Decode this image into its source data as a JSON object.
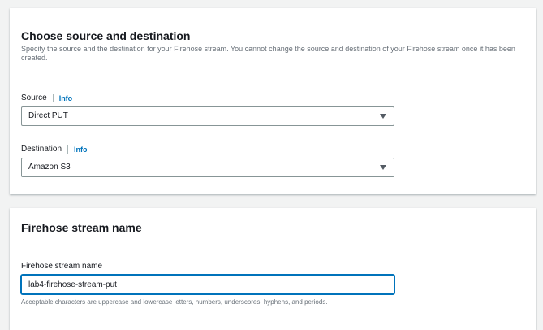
{
  "source_destination": {
    "title": "Choose source and destination",
    "description": "Specify the source and the destination for your Firehose stream. You cannot change the source and destination of your Firehose stream once it has been created.",
    "source": {
      "label": "Source",
      "info": "Info",
      "value": "Direct PUT"
    },
    "destination": {
      "label": "Destination",
      "info": "Info",
      "value": "Amazon S3"
    }
  },
  "stream_name": {
    "title": "Firehose stream name",
    "field_label": "Firehose stream name",
    "value": "lab4-firehose-stream-put",
    "hint": "Acceptable characters are uppercase and lowercase letters, numbers, underscores, hyphens, and periods."
  },
  "colors": {
    "link": "#0073bb",
    "focus_border": "#0073bb",
    "page_background": "#f2f3f3"
  }
}
